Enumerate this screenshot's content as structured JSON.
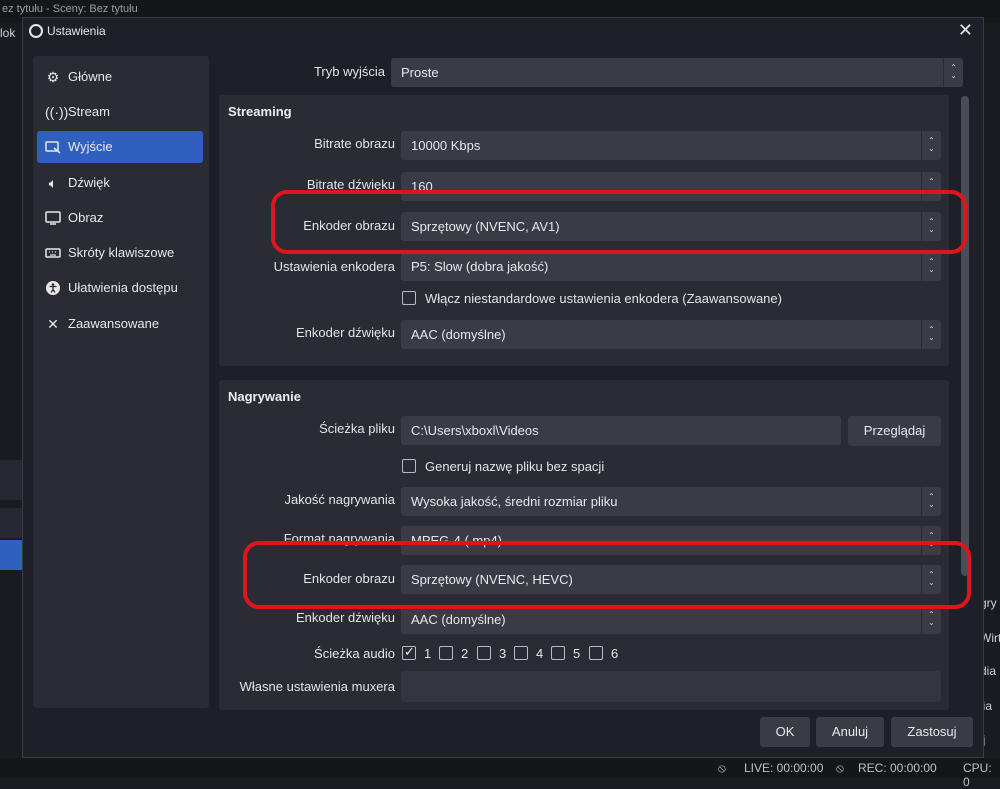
{
  "background": {
    "app_title": "ez tytułu - Sceny: Bez tytułu",
    "left_text": "lok",
    "right_items": [
      "gry",
      "Wirt",
      "dia",
      "lia",
      "ij"
    ],
    "status": {
      "live": "LIVE: 00:00:00",
      "rec": "REC: 00:00:00",
      "cpu": "CPU: 0"
    }
  },
  "dialog": {
    "title": "Ustawienia",
    "sidebar": [
      {
        "label": "Główne",
        "icon": "gear-icon"
      },
      {
        "label": "Stream",
        "icon": "broadcast-icon"
      },
      {
        "label": "Wyjście",
        "icon": "output-icon"
      },
      {
        "label": "Dźwięk",
        "icon": "speaker-icon"
      },
      {
        "label": "Obraz",
        "icon": "monitor-icon"
      },
      {
        "label": "Skróty klawiszowe",
        "icon": "keyboard-icon"
      },
      {
        "label": "Ułatwienia dostępu",
        "icon": "accessibility-icon"
      },
      {
        "label": "Zaawansowane",
        "icon": "tools-icon"
      }
    ],
    "output_mode": {
      "label": "Tryb wyjścia",
      "value": "Proste"
    },
    "streaming": {
      "title": "Streaming",
      "video_bitrate": {
        "label": "Bitrate obrazu",
        "value": "10000 Kbps"
      },
      "audio_bitrate": {
        "label": "Bitrate dźwięku",
        "value": "160"
      },
      "video_encoder": {
        "label": "Enkoder obrazu",
        "value": "Sprzętowy (NVENC, AV1)"
      },
      "encoder_settings": {
        "label": "Ustawienia enkodera",
        "value": "P5: Slow (dobra jakość)"
      },
      "custom_encoder_checkbox": {
        "label": "Włącz niestandardowe ustawienia enkodera (Zaawansowane)",
        "checked": false
      },
      "audio_encoder": {
        "label": "Enkoder dźwięku",
        "value": "AAC (domyślne)"
      }
    },
    "recording": {
      "title": "Nagrywanie",
      "file_path": {
        "label": "Ścieżka pliku",
        "value": "C:\\Users\\xboxl\\Videos",
        "browse": "Przeglądaj"
      },
      "no_space_checkbox": {
        "label": "Generuj nazwę pliku bez spacji",
        "checked": false
      },
      "quality": {
        "label": "Jakość nagrywania",
        "value": "Wysoka jakość, średni rozmiar pliku"
      },
      "format": {
        "label": "Format nagrywania",
        "value": "MPEG-4 (.mp4)"
      },
      "video_encoder": {
        "label": "Enkoder obrazu",
        "value": "Sprzętowy (NVENC, HEVC)"
      },
      "audio_encoder": {
        "label": "Enkoder dźwięku",
        "value": "AAC (domyślne)"
      },
      "audio_track": {
        "label": "Ścieżka audio",
        "tracks": [
          "1",
          "2",
          "3",
          "4",
          "5",
          "6"
        ],
        "checked": [
          true,
          false,
          false,
          false,
          false,
          false
        ]
      },
      "muxer": {
        "label": "Własne ustawienia muxera",
        "value": ""
      }
    },
    "buttons": {
      "ok": "OK",
      "cancel": "Anuluj",
      "apply": "Zastosuj"
    },
    "highlight_color": "#e0141e",
    "accent_color": "#2f5fbf"
  }
}
